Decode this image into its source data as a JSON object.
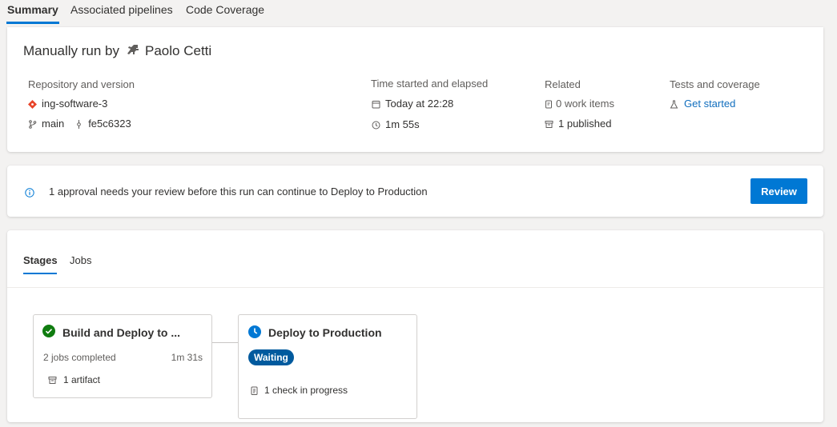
{
  "nav": {
    "tabs": [
      {
        "label": "Summary",
        "active": true
      },
      {
        "label": "Associated pipelines",
        "active": false
      },
      {
        "label": "Code Coverage",
        "active": false
      }
    ]
  },
  "summary": {
    "run_prefix": "Manually run by",
    "run_user": "Paolo Cetti",
    "repo": {
      "heading": "Repository and version",
      "name": "ing-software-3",
      "branch": "main",
      "commit": "fe5c6323"
    },
    "time": {
      "heading": "Time started and elapsed",
      "started": "Today at 22:28",
      "elapsed": "1m 55s"
    },
    "related": {
      "heading": "Related",
      "work_items": "0 work items",
      "published": "1 published"
    },
    "tests": {
      "heading": "Tests and coverage",
      "link": "Get started"
    }
  },
  "approval": {
    "message": "1 approval needs your review before this run can continue to Deploy to Production",
    "button": "Review"
  },
  "stages_panel": {
    "tabs": [
      {
        "label": "Stages",
        "active": true
      },
      {
        "label": "Jobs",
        "active": false
      }
    ],
    "stages": [
      {
        "name": "Build and Deploy to ...",
        "status": "succeeded",
        "jobs": "2 jobs completed",
        "duration": "1m 31s",
        "artifact": "1 artifact"
      },
      {
        "name": "Deploy to Production",
        "status": "waiting",
        "badge": "Waiting",
        "check": "1 check in progress"
      }
    ]
  },
  "colors": {
    "accent": "#0078d4",
    "success": "#107c10",
    "waiting_badge": "#005a9e",
    "git_icon": "#e8442a"
  }
}
